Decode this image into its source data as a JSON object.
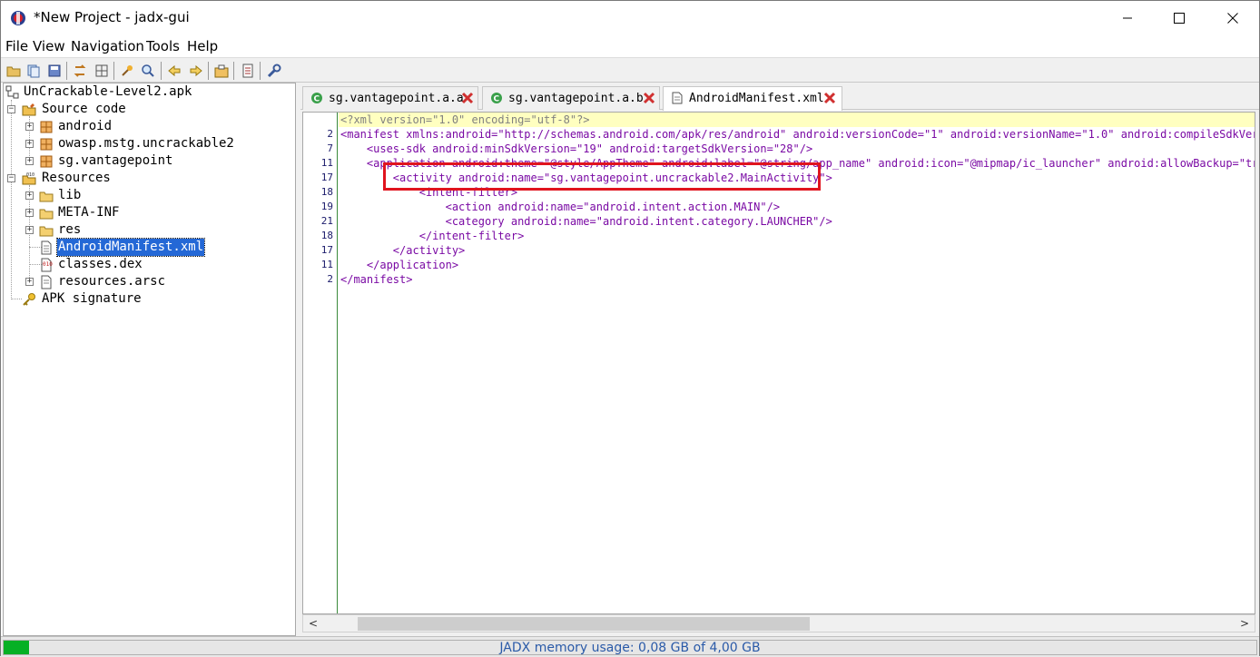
{
  "window": {
    "title": "*New Project - jadx-gui"
  },
  "menu": [
    "File",
    "View",
    "Navigation",
    "Tools",
    "Help"
  ],
  "toolbar": {
    "icons": [
      "open-file-icon",
      "add-files-icon",
      "save-all-icon",
      "sync-tree-icon",
      "flatten-packages-icon",
      "deobfuscation-icon",
      "search-icon",
      "back-icon",
      "forward-icon",
      "decompile-all-icon",
      "log-icon",
      "preferences-icon"
    ]
  },
  "tree": {
    "root": "UnCrackable-Level2.apk",
    "source_code": "Source code",
    "packages": [
      "android",
      "owasp.mstg.uncrackable2",
      "sg.vantagepoint"
    ],
    "resources": "Resources",
    "resource_items": [
      "lib",
      "META-INF",
      "res",
      "AndroidManifest.xml",
      "classes.dex",
      "resources.arsc"
    ],
    "selected": "AndroidManifest.xml",
    "apk_signature": "APK signature"
  },
  "tabs": [
    {
      "label": "sg.vantagepoint.a.a",
      "icon": "class-icon"
    },
    {
      "label": "sg.vantagepoint.a.b",
      "icon": "class-icon"
    },
    {
      "label": "AndroidManifest.xml",
      "icon": "file-icon",
      "active": true
    }
  ],
  "code": {
    "line_numbers": [
      "",
      "2",
      "7",
      "11",
      "17",
      "18",
      "19",
      "21",
      "18",
      "17",
      "11",
      "2"
    ],
    "lines": [
      "<?xml version=\"1.0\" encoding=\"utf-8\"?>",
      "<manifest xmlns:android=\"http://schemas.android.com/apk/res/android\" android:versionCode=\"1\" android:versionName=\"1.0\" android:compileSdkVersion",
      "    <uses-sdk android:minSdkVersion=\"19\" android:targetSdkVersion=\"28\"/>",
      "    <application android:theme=\"@style/AppTheme\" android:label=\"@string/app_name\" android:icon=\"@mipmap/ic_launcher\" android:allowBackup=\"true\"",
      "        <activity android:name=\"sg.vantagepoint.uncrackable2.MainActivity\">",
      "            <intent-filter>",
      "                <action android:name=\"android.intent.action.MAIN\"/>",
      "                <category android:name=\"android.intent.category.LAUNCHER\"/>",
      "            </intent-filter>",
      "        </activity>",
      "    </application>",
      "</manifest>"
    ]
  },
  "status": {
    "memory_text": "JADX memory usage: 0,08 GB of 4,00 GB",
    "memory_fraction": 0.02
  },
  "colors": {
    "highlight_box": "#e0141e",
    "memory_bar": "#06b025",
    "selection": "#2468d6"
  }
}
